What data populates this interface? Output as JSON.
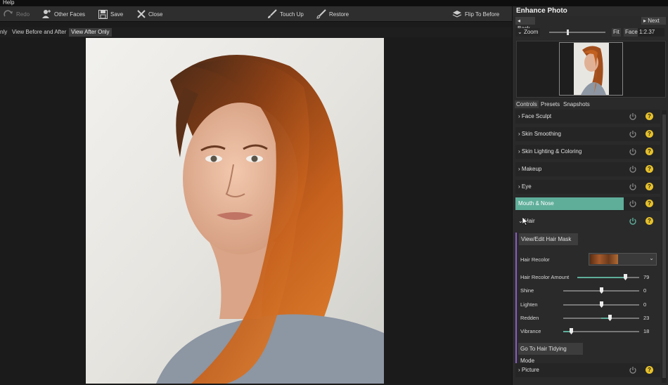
{
  "menubar": {
    "help": "Help"
  },
  "toolbar": {
    "redo": "Redo",
    "other_faces": "Other Faces",
    "save": "Save",
    "close": "Close",
    "touch_up": "Touch Up",
    "restore": "Restore",
    "flip_to_before": "Flip To Before"
  },
  "viewbar": {
    "only": "nly",
    "before_after": "View Before and After",
    "after_only": "View After Only"
  },
  "panel": {
    "title": "Enhance Photo",
    "back": "Back",
    "next": "Next",
    "zoom_label": "Zoom",
    "fit": "Fit",
    "face": "Face",
    "ratio": "1:2.37",
    "tabs": [
      "Controls",
      "Presets",
      "Snapshots"
    ],
    "sections": {
      "face_sculpt": "Face Sculpt",
      "skin_smoothing": "Skin Smoothing",
      "skin_lighting": "Skin Lighting & Coloring",
      "makeup": "Makeup",
      "eye": "Eye",
      "mouth_nose": "Mouth & Nose",
      "hair": "Hair",
      "picture": "Picture"
    },
    "hair": {
      "view_edit_mask": "View/Edit Hair Mask",
      "recolor_label": "Hair Recolor",
      "recolor_amount_label": "Hair Recolor Amount",
      "recolor_amount": "79",
      "shine_label": "Shine",
      "shine": "0",
      "lighten_label": "Lighten",
      "lighten": "0",
      "redden_label": "Redden",
      "redden": "23",
      "vibrance_label": "Vibrance",
      "vibrance": "18",
      "tidying": "Go To Hair Tidying Mode"
    },
    "help_glyph": "?"
  },
  "colors": {
    "accent": "#5fae9a",
    "help": "#e6c02a",
    "hair_bar": "#8a5cc0"
  }
}
